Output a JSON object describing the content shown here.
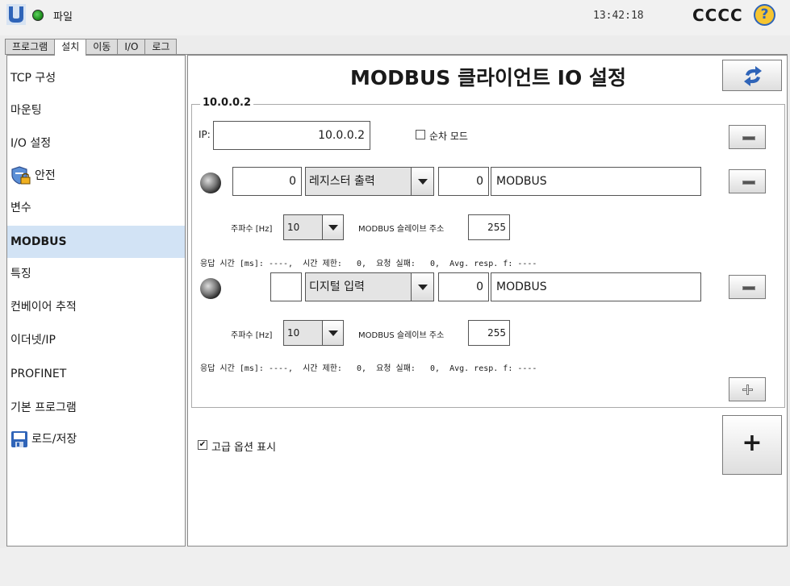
{
  "topbar": {
    "file_menu": "파일",
    "clock": "13:42:18",
    "robot_name": "CCCC",
    "help": "?"
  },
  "tabs": [
    {
      "label": "프로그램"
    },
    {
      "label": "설치"
    },
    {
      "label": "이동"
    },
    {
      "label": "I/O"
    },
    {
      "label": "로그"
    }
  ],
  "sidebar": {
    "items": [
      {
        "label": "TCP 구성"
      },
      {
        "label": "마운팅"
      },
      {
        "label": "I/O 설정"
      },
      {
        "label": "안전"
      },
      {
        "label": "변수"
      },
      {
        "label": "MODBUS"
      },
      {
        "label": "특징"
      },
      {
        "label": "컨베이어 추적"
      },
      {
        "label": "이더넷/IP"
      },
      {
        "label": "PROFINET"
      },
      {
        "label": "기본 프로그램"
      },
      {
        "label": "로드/저장"
      }
    ]
  },
  "main": {
    "title": "MODBUS 클라이언트 IO 설정",
    "group_label": "10.0.0.2",
    "ip_label": "IP:",
    "ip_value": "10.0.0.2",
    "sequential_label": "순차 모드",
    "signals": [
      {
        "number": "0",
        "type": "레지스터 출력",
        "address": "0",
        "name": "MODBUS",
        "freq_label": "주파수 [Hz]",
        "freq": "10",
        "slave_label": "MODBUS 슬레이브 주소",
        "slave": "255",
        "stats": "응답 시간 [ms]: ----,  시간 제한:   0,  요청 실패:   0,  Avg. resp. f: ----"
      },
      {
        "number": "",
        "type": "디지털 입력",
        "address": "0",
        "name": "MODBUS",
        "freq_label": "주파수 [Hz]",
        "freq": "10",
        "slave_label": "MODBUS 슬레이브 주소",
        "slave": "255",
        "stats": "응답 시간 [ms]: ----,  시간 제한:   0,  요청 실패:   0,  Avg. resp. f: ----"
      }
    ],
    "advanced_label": "고급 옵션 표시",
    "advanced_checked": "✔",
    "add_server": "+"
  }
}
